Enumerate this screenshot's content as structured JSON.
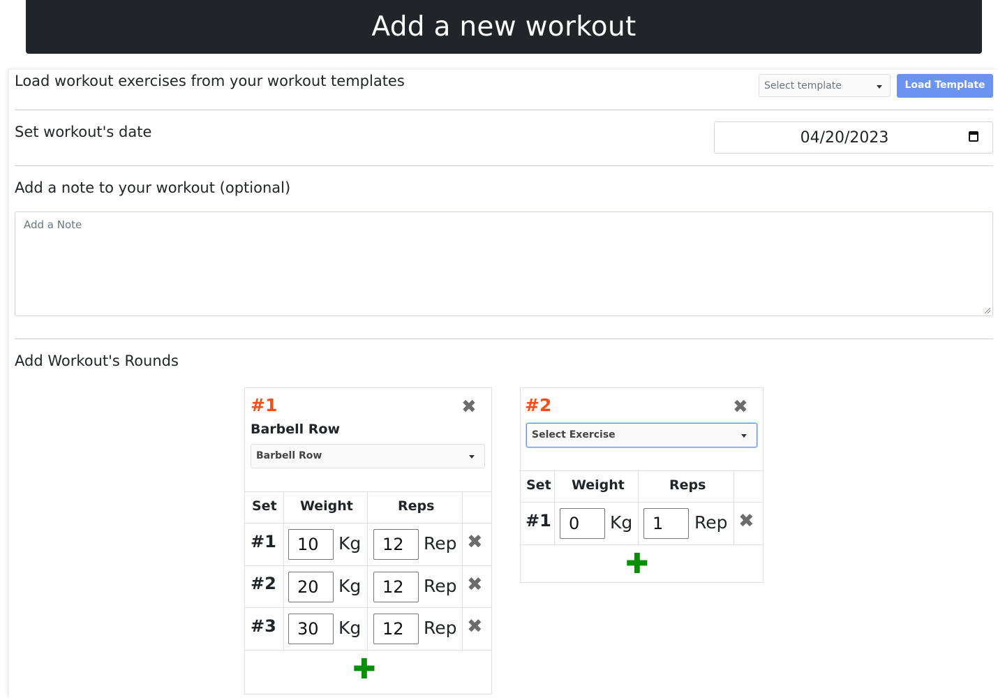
{
  "header": {
    "title": "Add a new workout"
  },
  "template": {
    "label": "Load workout exercises from your workout templates",
    "select_placeholder": "Select template",
    "load_button": "Load Template"
  },
  "date": {
    "label": "Set workout's date",
    "value": "04/20/2023"
  },
  "note": {
    "label": "Add a note to your workout (optional)",
    "placeholder": "Add a Note"
  },
  "rounds": {
    "label": "Add Workout's Rounds",
    "headers": {
      "set": "Set",
      "weight": "Weight",
      "reps": "Reps"
    },
    "weight_unit": "Kg",
    "reps_unit": "Rep",
    "add_icon": "plus-icon",
    "remove_icon": "close-icon",
    "items": [
      {
        "number": "#1",
        "exercise_name": "Barbell Row",
        "exercise_select": "Barbell Row",
        "sets": [
          {
            "set": "#1",
            "weight": "10",
            "reps": "12"
          },
          {
            "set": "#2",
            "weight": "20",
            "reps": "12"
          },
          {
            "set": "#3",
            "weight": "30",
            "reps": "12"
          }
        ]
      },
      {
        "number": "#2",
        "exercise_name": "",
        "exercise_select": "Select Exercise",
        "sets": [
          {
            "set": "#1",
            "weight": "0",
            "reps": "1"
          }
        ]
      }
    ]
  },
  "colors": {
    "header_bg": "#212529",
    "accent_button": "#6b93f2",
    "round_number": "#fd4c15",
    "add_green": "#088f08"
  }
}
